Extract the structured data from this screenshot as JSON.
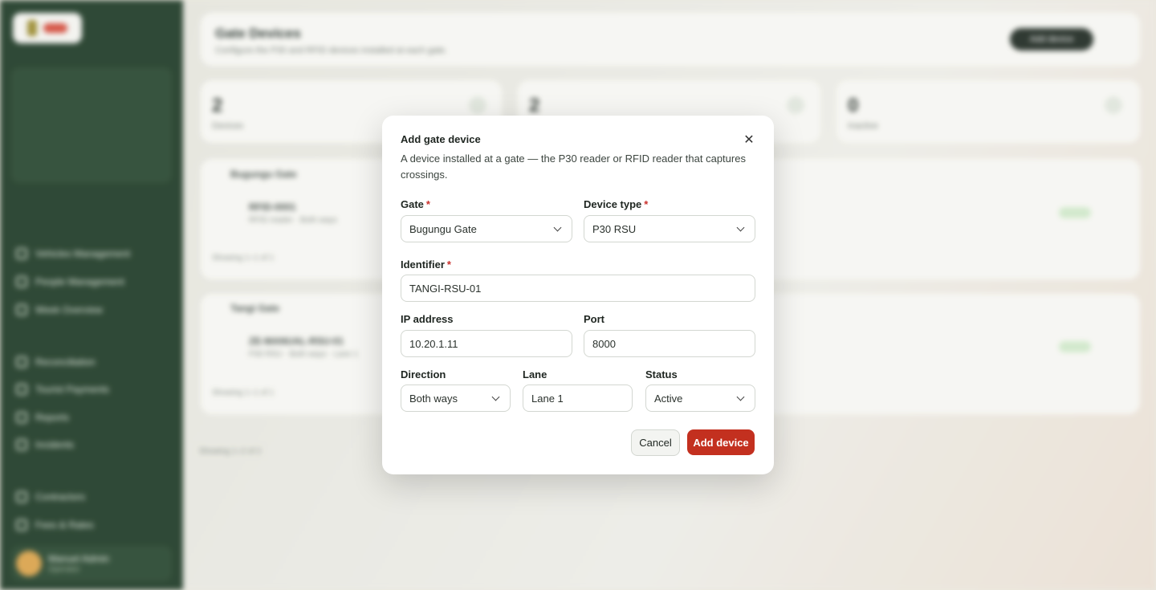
{
  "modal": {
    "title": "Add gate device",
    "description": "A device installed at a gate — the P30 reader or RFID reader that captures crossings.",
    "gate": {
      "label": "Gate",
      "value": "Bugungu Gate"
    },
    "device_type": {
      "label": "Device type",
      "value": "P30 RSU"
    },
    "identifier": {
      "label": "Identifier",
      "value": "TANGI-RSU-01"
    },
    "ip_address": {
      "label": "IP address",
      "value": "10.20.1.11"
    },
    "port": {
      "label": "Port",
      "value": "8000"
    },
    "direction": {
      "label": "Direction",
      "value": "Both ways"
    },
    "lane": {
      "label": "Lane",
      "value": "Lane 1"
    },
    "status": {
      "label": "Status",
      "value": "Active"
    },
    "required_mark": "*",
    "cancel_label": "Cancel",
    "submit_label": "Add device"
  },
  "background": {
    "page_title": "Gate Devices",
    "page_subtitle": "Configure the P30 and RFID devices installed at each gate.",
    "header_button": "Add device",
    "stats": [
      {
        "value": "2",
        "label": "Devices"
      },
      {
        "value": "2",
        "label": ""
      },
      {
        "value": "0",
        "label": "Inactive"
      }
    ],
    "sections": [
      {
        "title": "Bugungu Gate",
        "row_id": "RFID-0001",
        "row_sub": "RFID reader · Both ways",
        "footer": "Showing 1–1 of 1"
      },
      {
        "title": "Tangi Gate",
        "row_id": "ZE-MANUAL-RSU-01",
        "row_sub": "P30 RSU · Both ways · Lane 1",
        "footer": "Showing 1–1 of 1"
      }
    ],
    "page_footer": "Showing 1–2 of 2",
    "sidebar": {
      "items": [
        "Vehicles Management",
        "People Management",
        "Week Overview",
        "Reconciliation",
        "Tourist Payments",
        "Reports",
        "Incidents",
        "Contractors",
        "Fees & Rates"
      ],
      "user_name": "Manuel Admin",
      "user_role": "Operator"
    }
  },
  "colors": {
    "accent": "#c3301f",
    "sidebar": "#1e3a26",
    "required": "#c9302c"
  }
}
